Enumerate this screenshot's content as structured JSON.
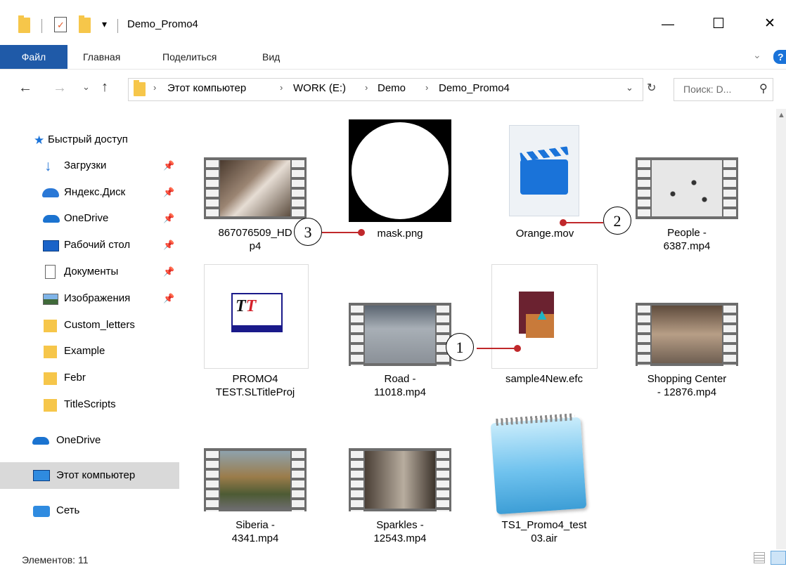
{
  "window": {
    "title": "Demo_Promo4",
    "minimize": "—",
    "maximize": "☐",
    "close": "✕"
  },
  "ribbon": {
    "file": "Файл",
    "home": "Главная",
    "share": "Поделиться",
    "view": "Вид",
    "help": "?"
  },
  "address": {
    "crumbs": [
      "Этот компьютер",
      "WORK (E:)",
      "Demo",
      "Demo_Promo4"
    ],
    "search_placeholder": "Поиск: D..."
  },
  "nav": {
    "quick_access": "Быстрый доступ",
    "items": [
      {
        "label": "Загрузки",
        "icon": "download-icon",
        "pinned": true
      },
      {
        "label": "Яндекс.Диск",
        "icon": "yandex-disk-icon",
        "pinned": true
      },
      {
        "label": "OneDrive",
        "icon": "onedrive-icon",
        "pinned": true
      },
      {
        "label": "Рабочий стол",
        "icon": "desktop-icon",
        "pinned": true
      },
      {
        "label": "Документы",
        "icon": "documents-icon",
        "pinned": true
      },
      {
        "label": "Изображения",
        "icon": "pictures-icon",
        "pinned": true
      },
      {
        "label": "Custom_letters",
        "icon": "folder-icon",
        "pinned": false
      },
      {
        "label": "Example",
        "icon": "folder-icon",
        "pinned": false
      },
      {
        "label": "Febr",
        "icon": "folder-icon",
        "pinned": false
      },
      {
        "label": "TitleScripts",
        "icon": "folder-icon",
        "pinned": false
      }
    ],
    "onedrive": "OneDrive",
    "this_pc": "Этот компьютер",
    "network": "Сеть"
  },
  "files": [
    {
      "name_l1": "867076509_HD",
      "name_l2": "p4",
      "type": "video"
    },
    {
      "name_l1": "mask.png",
      "name_l2": "",
      "type": "image"
    },
    {
      "name_l1": "Orange.mov",
      "name_l2": "",
      "type": "mov"
    },
    {
      "name_l1": "People -",
      "name_l2": "6387.mp4",
      "type": "video"
    },
    {
      "name_l1": "PROMO4",
      "name_l2": "TEST.SLTitleProj",
      "type": "project"
    },
    {
      "name_l1": "Road -",
      "name_l2": "11018.mp4",
      "type": "video"
    },
    {
      "name_l1": "sample4New.efc",
      "name_l2": "",
      "type": "efc"
    },
    {
      "name_l1": "Shopping Center",
      "name_l2": "- 12876.mp4",
      "type": "video"
    },
    {
      "name_l1": "Siberia -",
      "name_l2": "4341.mp4",
      "type": "video"
    },
    {
      "name_l1": "Sparkles -",
      "name_l2": "12543.mp4",
      "type": "video"
    },
    {
      "name_l1": "TS1_Promo4_test",
      "name_l2": "03.air",
      "type": "notepad"
    }
  ],
  "callouts": [
    "1",
    "2",
    "3"
  ],
  "status": {
    "count": "Элементов: 11"
  },
  "colors": {
    "accent": "#1f5aa8",
    "callout": "#c0282b",
    "folder": "#f6c64a"
  }
}
